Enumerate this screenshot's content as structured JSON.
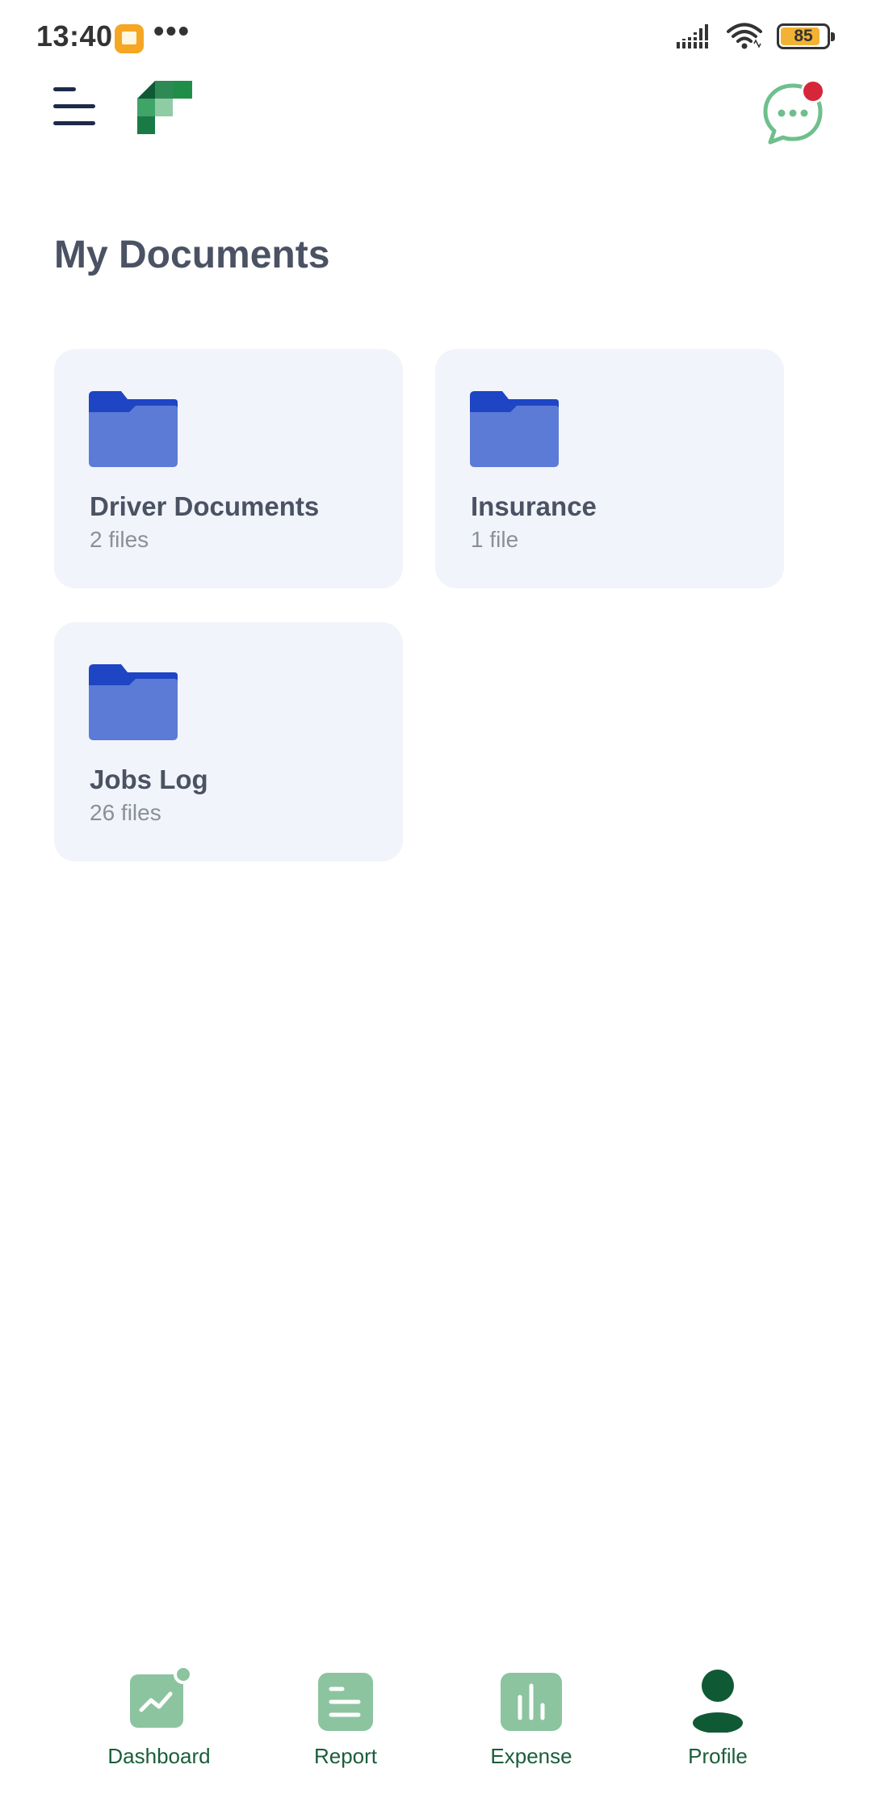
{
  "status_bar": {
    "time": "13:40",
    "more_dots": "•••",
    "battery_level": "85",
    "battery_fraction": 0.85,
    "icons": [
      "notification-app-icon",
      "signal-icon",
      "wifi-icon",
      "battery-icon"
    ]
  },
  "header": {
    "menu_icon": "hamburger-menu-icon",
    "logo_icon": "app-logo",
    "chat_icon": "chat-bubble-icon",
    "chat_has_notification": true
  },
  "page": {
    "title": "My Documents"
  },
  "folders": [
    {
      "name": "Driver Documents",
      "count": "2 files",
      "icon": "folder-icon"
    },
    {
      "name": "Insurance",
      "count": "1 file",
      "icon": "folder-icon"
    },
    {
      "name": "Jobs Log",
      "count": "26 files",
      "icon": "folder-icon"
    }
  ],
  "bottom_nav": {
    "items": [
      {
        "label": "Dashboard",
        "icon": "dashboard-chart-icon",
        "active": false
      },
      {
        "label": "Report",
        "icon": "report-list-icon",
        "active": false
      },
      {
        "label": "Expense",
        "icon": "expense-bars-icon",
        "active": false
      },
      {
        "label": "Profile",
        "icon": "profile-person-icon",
        "active": true
      }
    ]
  },
  "colors": {
    "accent_green": "#1a7a45",
    "nav_icon_inactive": "#8cc4a0",
    "nav_icon_active": "#0f5a34",
    "folder_front": "#5b7bd6",
    "folder_back": "#1e45c4",
    "card_background": "#f2f4fb",
    "notification_red": "#d6263a"
  }
}
